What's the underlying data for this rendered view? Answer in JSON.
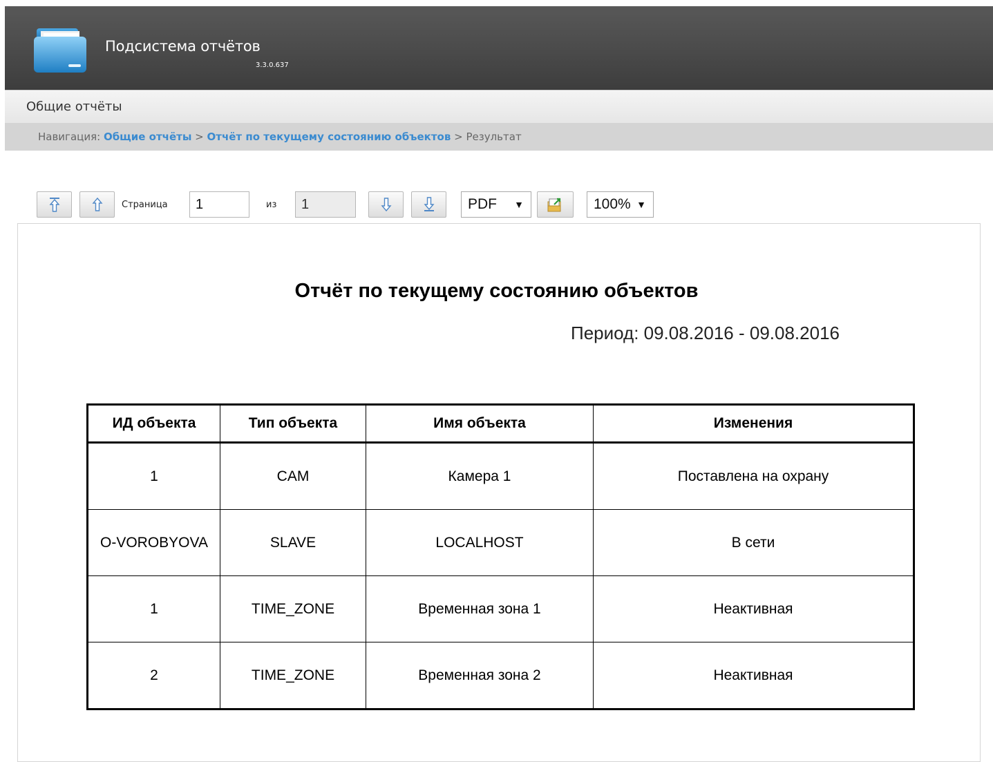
{
  "app": {
    "title": "Подсистема отчётов",
    "version": "3.3.0.637"
  },
  "section": {
    "title": "Общие отчёты"
  },
  "breadcrumb": {
    "prefix": "Навигация: ",
    "link1": "Общие отчёты",
    "sep1": " > ",
    "link2": "Отчёт по текущему состоянию объектов",
    "sep2": " > ",
    "current": "Результат"
  },
  "toolbar": {
    "page_label": "Страница",
    "page_value": "1",
    "of_label": "из",
    "total_pages": "1",
    "format_selected": "PDF",
    "zoom_selected": "100%",
    "buttons": {
      "first": "arrow-first-page-icon",
      "prev": "arrow-prev-page-icon",
      "next": "arrow-next-page-icon",
      "last": "arrow-last-page-icon",
      "export": "export-icon"
    }
  },
  "report": {
    "title": "Отчёт по текущему состоянию объектов",
    "period": "Период: 09.08.2016 - 09.08.2016",
    "columns": [
      "ИД объекта",
      "Тип объекта",
      "Имя объекта",
      "Изменения"
    ],
    "rows": [
      [
        "1",
        "CAM",
        "Камера 1",
        "Поставлена на охрану"
      ],
      [
        "O-VOROBYOVA",
        "SLAVE",
        "LOCALHOST",
        "В сети"
      ],
      [
        "1",
        "TIME_ZONE",
        "Временная зона 1",
        "Неактивная"
      ],
      [
        "2",
        "TIME_ZONE",
        "Временная зона 2",
        "Неактивная"
      ]
    ]
  },
  "colors": {
    "header_bg": "#4a4a4a",
    "link": "#3b8bd0",
    "nav_bg": "#d4d4d4"
  }
}
